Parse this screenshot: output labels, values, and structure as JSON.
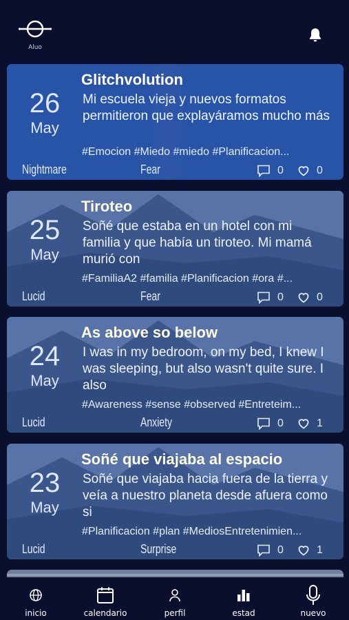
{
  "header": {
    "logo_label": "Aluo"
  },
  "cards": [
    {
      "day": "26",
      "month": "May",
      "title": "Glitchvolution",
      "text": "Mi escuela vieja y nuevos formatos permitieron que explayáramos mucho más",
      "tags": "#Emocion #Miedo #miedo #Planificacion...",
      "type": "Nightmare",
      "emotion": "Fear",
      "comments": "0",
      "likes": "0"
    },
    {
      "day": "25",
      "month": "May",
      "title": "Tiroteo",
      "text": "Soñé que estaba en un hotel con mi familia y que había un tiroteo. Mi mamá murió con",
      "tags": "#FamiliaA2 #familia #Planificacion #ora #...",
      "type": "Lucid",
      "emotion": "Fear",
      "comments": "0",
      "likes": "0"
    },
    {
      "day": "24",
      "month": "May",
      "title": "As above so below",
      "text": "I was in my bedroom, on my bed, I knew I was sleeping, but also wasn't quite sure. I also",
      "tags": "#Awareness #sense #observed #Entreteim...",
      "type": "Lucid",
      "emotion": "Anxiety",
      "comments": "0",
      "likes": "1"
    },
    {
      "day": "23",
      "month": "May",
      "title": "Soñé que viajaba al espacio",
      "text": "Soñé que viajaba hacia fuera de la tierra y veía a nuestro planeta desde afuera como si",
      "tags": "#Planificacion #plan #MediosEntretenimien...",
      "type": "Lucid",
      "emotion": "Surprise",
      "comments": "0",
      "likes": "1"
    }
  ],
  "tabbar": {
    "items": [
      {
        "label": "inicio",
        "icon": "globe-icon"
      },
      {
        "label": "calendario",
        "icon": "calendar-icon"
      },
      {
        "label": "perfil",
        "icon": "person-icon"
      },
      {
        "label": "estad",
        "icon": "bar-chart-icon"
      },
      {
        "label": "nuevo",
        "icon": "microphone-icon"
      }
    ]
  },
  "colors": {
    "background": "#0b0f2e",
    "card_first": "#2856a8",
    "title": "#fffbe0"
  }
}
